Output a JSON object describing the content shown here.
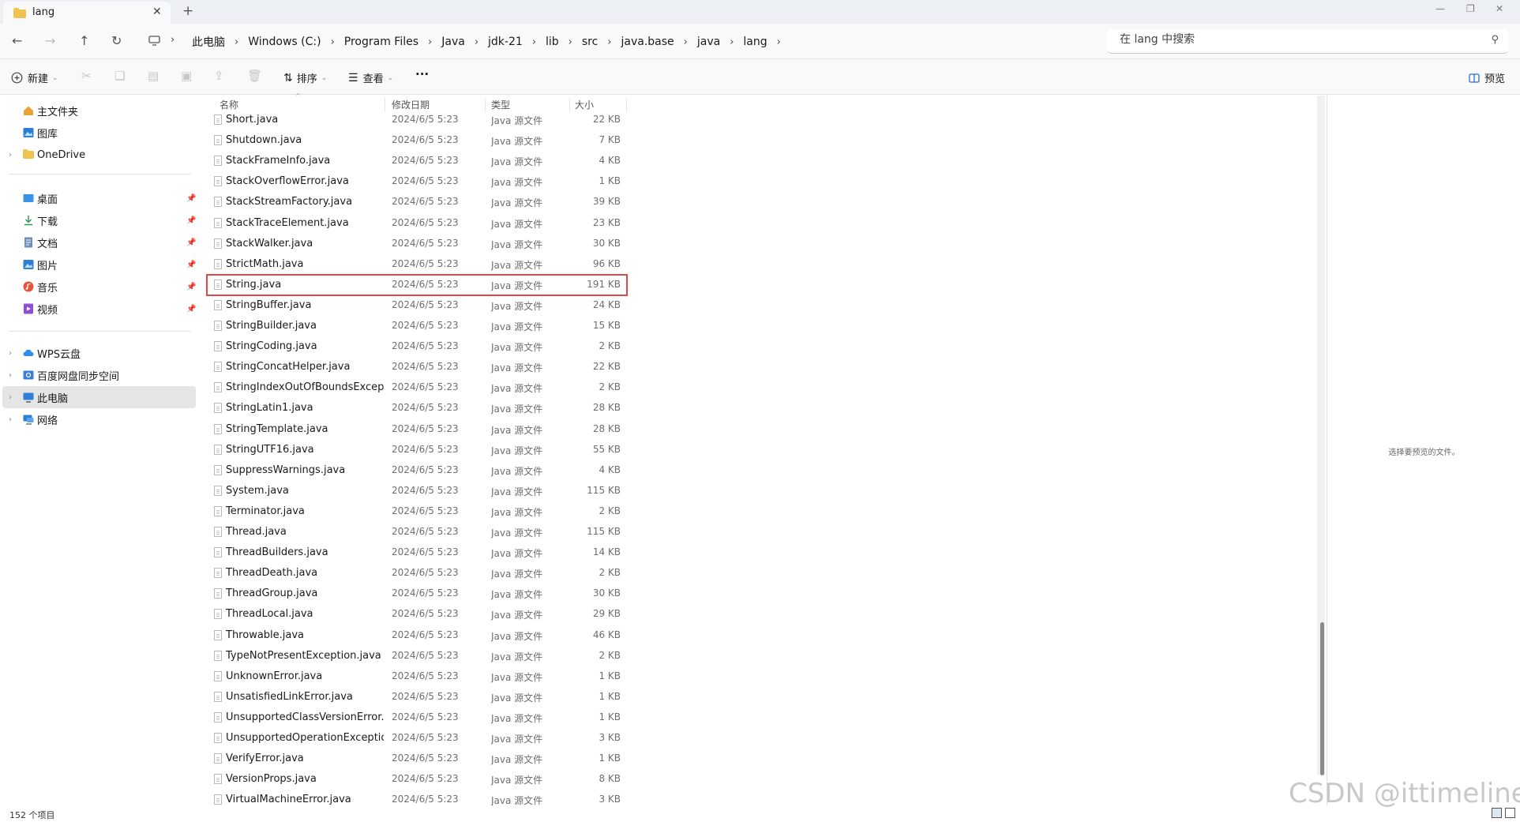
{
  "window": {
    "tab_title": "lang",
    "new_tab_label": "+",
    "close_tab_label": "✕"
  },
  "address": {
    "breadcrumbs": [
      "此电脑",
      "Windows (C:)",
      "Program Files",
      "Java",
      "jdk-21",
      "lib",
      "src",
      "java.base",
      "java",
      "lang"
    ],
    "search_placeholder": "在 lang 中搜索"
  },
  "toolbar": {
    "new_label": "新建",
    "sort_label": "排序",
    "view_label": "查看",
    "more_label": "···",
    "preview_label": "预览"
  },
  "sidebar": {
    "items": [
      {
        "label": "主文件夹",
        "icon": "home-icon",
        "color": "#e8a23a"
      },
      {
        "label": "图库",
        "icon": "gallery-icon",
        "color": "#2f7fd8"
      },
      {
        "label": "OneDrive",
        "icon": "folder-icon",
        "color": "#f1c24f"
      },
      {
        "label": "桌面",
        "icon": "desktop-icon",
        "color": "#3a93e6"
      },
      {
        "label": "下载",
        "icon": "download-icon",
        "color": "#2e9c58"
      },
      {
        "label": "文档",
        "icon": "document-icon",
        "color": "#6d8fb8"
      },
      {
        "label": "图片",
        "icon": "pictures-icon",
        "color": "#2f7fd8"
      },
      {
        "label": "音乐",
        "icon": "music-icon",
        "color": "#e2553b"
      },
      {
        "label": "视频",
        "icon": "video-icon",
        "color": "#8d4fd8"
      },
      {
        "label": "WPS云盘",
        "icon": "cloud-icon",
        "color": "#2f8ff0"
      },
      {
        "label": "百度网盘同步空间",
        "icon": "sync-folder-icon",
        "color": "#3a7de0"
      },
      {
        "label": "此电脑",
        "icon": "computer-icon",
        "color": "#2f7fd8"
      },
      {
        "label": "网络",
        "icon": "network-icon",
        "color": "#2f7fd8"
      }
    ]
  },
  "filelist": {
    "columns": {
      "name": "名称",
      "date": "修改日期",
      "type": "类型",
      "size": "大小"
    },
    "rows": [
      {
        "name": "Short.java",
        "date": "2024/6/5 5:23",
        "type": "Java 源文件",
        "size": "22 KB"
      },
      {
        "name": "Shutdown.java",
        "date": "2024/6/5 5:23",
        "type": "Java 源文件",
        "size": "7 KB"
      },
      {
        "name": "StackFrameInfo.java",
        "date": "2024/6/5 5:23",
        "type": "Java 源文件",
        "size": "4 KB"
      },
      {
        "name": "StackOverflowError.java",
        "date": "2024/6/5 5:23",
        "type": "Java 源文件",
        "size": "1 KB"
      },
      {
        "name": "StackStreamFactory.java",
        "date": "2024/6/5 5:23",
        "type": "Java 源文件",
        "size": "39 KB"
      },
      {
        "name": "StackTraceElement.java",
        "date": "2024/6/5 5:23",
        "type": "Java 源文件",
        "size": "23 KB"
      },
      {
        "name": "StackWalker.java",
        "date": "2024/6/5 5:23",
        "type": "Java 源文件",
        "size": "30 KB"
      },
      {
        "name": "StrictMath.java",
        "date": "2024/6/5 5:23",
        "type": "Java 源文件",
        "size": "96 KB"
      },
      {
        "name": "String.java",
        "date": "2024/6/5 5:23",
        "type": "Java 源文件",
        "size": "191 KB"
      },
      {
        "name": "StringBuffer.java",
        "date": "2024/6/5 5:23",
        "type": "Java 源文件",
        "size": "24 KB"
      },
      {
        "name": "StringBuilder.java",
        "date": "2024/6/5 5:23",
        "type": "Java 源文件",
        "size": "15 KB"
      },
      {
        "name": "StringCoding.java",
        "date": "2024/6/5 5:23",
        "type": "Java 源文件",
        "size": "2 KB"
      },
      {
        "name": "StringConcatHelper.java",
        "date": "2024/6/5 5:23",
        "type": "Java 源文件",
        "size": "22 KB"
      },
      {
        "name": "StringIndexOutOfBoundsExcepti...",
        "date": "2024/6/5 5:23",
        "type": "Java 源文件",
        "size": "2 KB"
      },
      {
        "name": "StringLatin1.java",
        "date": "2024/6/5 5:23",
        "type": "Java 源文件",
        "size": "28 KB"
      },
      {
        "name": "StringTemplate.java",
        "date": "2024/6/5 5:23",
        "type": "Java 源文件",
        "size": "28 KB"
      },
      {
        "name": "StringUTF16.java",
        "date": "2024/6/5 5:23",
        "type": "Java 源文件",
        "size": "55 KB"
      },
      {
        "name": "SuppressWarnings.java",
        "date": "2024/6/5 5:23",
        "type": "Java 源文件",
        "size": "4 KB"
      },
      {
        "name": "System.java",
        "date": "2024/6/5 5:23",
        "type": "Java 源文件",
        "size": "115 KB"
      },
      {
        "name": "Terminator.java",
        "date": "2024/6/5 5:23",
        "type": "Java 源文件",
        "size": "2 KB"
      },
      {
        "name": "Thread.java",
        "date": "2024/6/5 5:23",
        "type": "Java 源文件",
        "size": "115 KB"
      },
      {
        "name": "ThreadBuilders.java",
        "date": "2024/6/5 5:23",
        "type": "Java 源文件",
        "size": "14 KB"
      },
      {
        "name": "ThreadDeath.java",
        "date": "2024/6/5 5:23",
        "type": "Java 源文件",
        "size": "2 KB"
      },
      {
        "name": "ThreadGroup.java",
        "date": "2024/6/5 5:23",
        "type": "Java 源文件",
        "size": "30 KB"
      },
      {
        "name": "ThreadLocal.java",
        "date": "2024/6/5 5:23",
        "type": "Java 源文件",
        "size": "29 KB"
      },
      {
        "name": "Throwable.java",
        "date": "2024/6/5 5:23",
        "type": "Java 源文件",
        "size": "46 KB"
      },
      {
        "name": "TypeNotPresentException.java",
        "date": "2024/6/5 5:23",
        "type": "Java 源文件",
        "size": "2 KB"
      },
      {
        "name": "UnknownError.java",
        "date": "2024/6/5 5:23",
        "type": "Java 源文件",
        "size": "1 KB"
      },
      {
        "name": "UnsatisfiedLinkError.java",
        "date": "2024/6/5 5:23",
        "type": "Java 源文件",
        "size": "1 KB"
      },
      {
        "name": "UnsupportedClassVersionError.ja...",
        "date": "2024/6/5 5:23",
        "type": "Java 源文件",
        "size": "1 KB"
      },
      {
        "name": "UnsupportedOperationExceptio...",
        "date": "2024/6/5 5:23",
        "type": "Java 源文件",
        "size": "3 KB"
      },
      {
        "name": "VerifyError.java",
        "date": "2024/6/5 5:23",
        "type": "Java 源文件",
        "size": "1 KB"
      },
      {
        "name": "VersionProps.java",
        "date": "2024/6/5 5:23",
        "type": "Java 源文件",
        "size": "8 KB"
      },
      {
        "name": "VirtualMachineError.java",
        "date": "2024/6/5 5:23",
        "type": "Java 源文件",
        "size": "3 KB"
      }
    ],
    "highlighted_file": "String.java",
    "highlight_color": "#e04848"
  },
  "preview_pane": {
    "message": "选择要预览的文件。"
  },
  "status": {
    "item_count": "152 个项目"
  },
  "watermark": "CSDN @ittimeline"
}
